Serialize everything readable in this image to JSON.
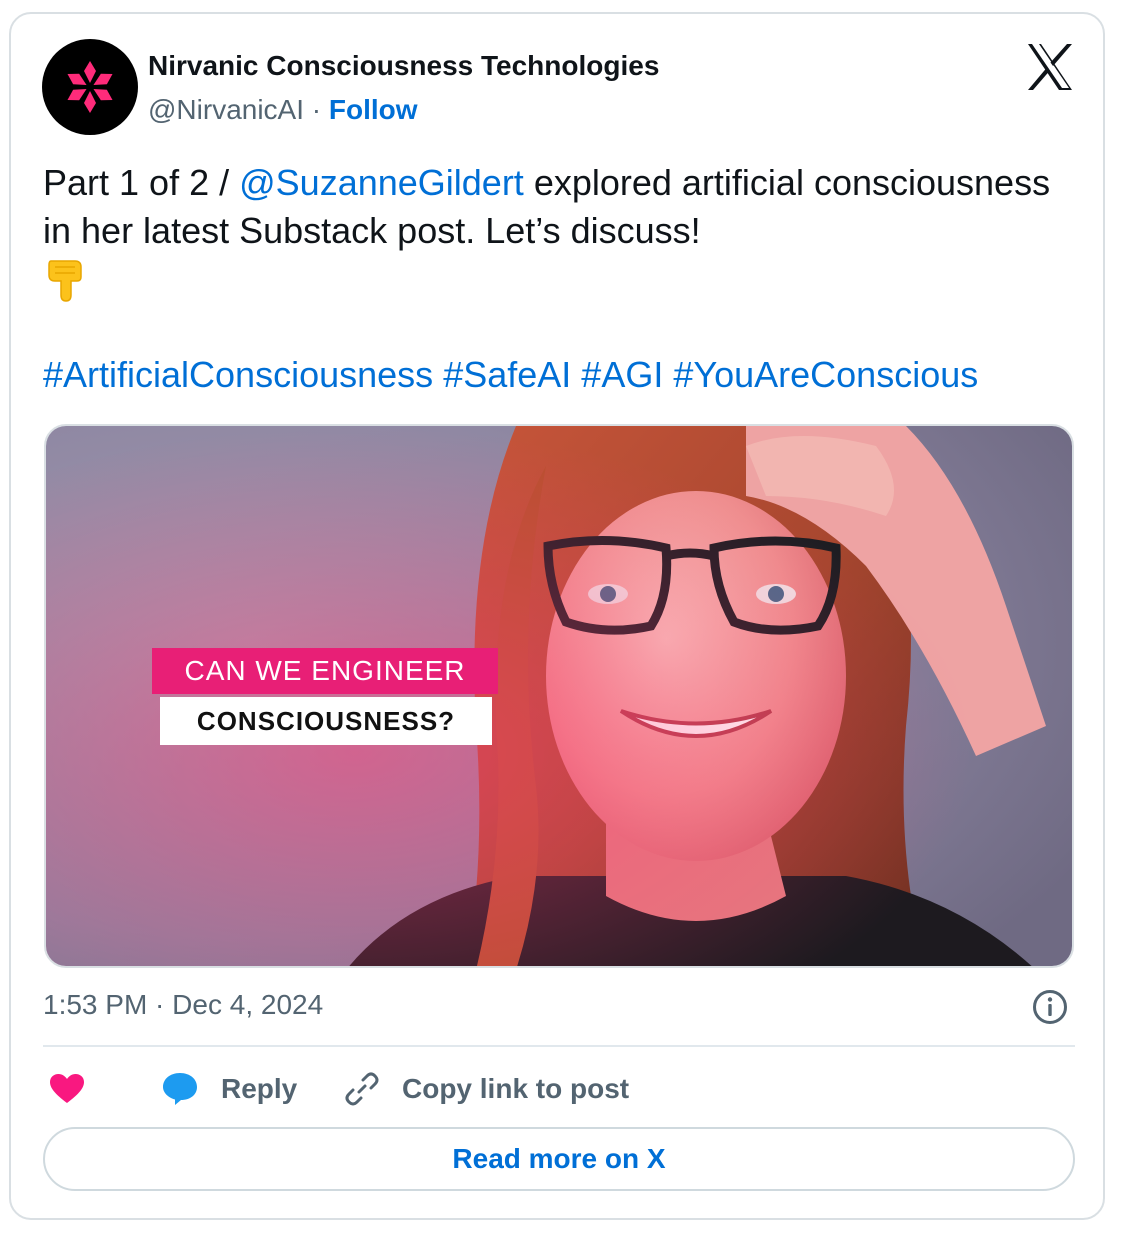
{
  "author": {
    "name": "Nirvanic Consciousness Technologies",
    "handle": "@NirvanicAI",
    "separator": " · ",
    "follow_label": "Follow",
    "avatar_icon": "pink-flower-logo-icon"
  },
  "brand_icon": "x-logo-icon",
  "tweet": {
    "prefix": "Part 1 of 2 / ",
    "mention": "@SuzanneGildert",
    "body": " explored artificial consciousness in her latest Substack post. Let’s discuss!",
    "emoji": "👇",
    "emoji_icon": "pointing-down-hand-icon",
    "hashtags": [
      "#ArtificialConsciousness",
      "#SafeAI",
      "#AGI",
      "#YouAreConscious"
    ]
  },
  "media": {
    "banner_line1": "CAN WE ENGINEER",
    "banner_line2": "CONSCIOUSNESS?"
  },
  "timestamp": {
    "time": "1:53 PM",
    "separator": " · ",
    "date": "Dec 4, 2024"
  },
  "actions": {
    "like_icon": "heart-icon",
    "reply_icon": "speech-bubble-icon",
    "reply_label": "Reply",
    "copy_icon": "link-icon",
    "copy_label": "Copy link to post",
    "info_icon": "info-icon"
  },
  "read_more_label": "Read more on X",
  "colors": {
    "link_blue": "#006fd6",
    "text_dark": "#0f1419",
    "text_gray": "#536471",
    "heart_pink": "#f91880",
    "reply_blue": "#1d9bf0",
    "banner_pink": "#e81f76"
  }
}
